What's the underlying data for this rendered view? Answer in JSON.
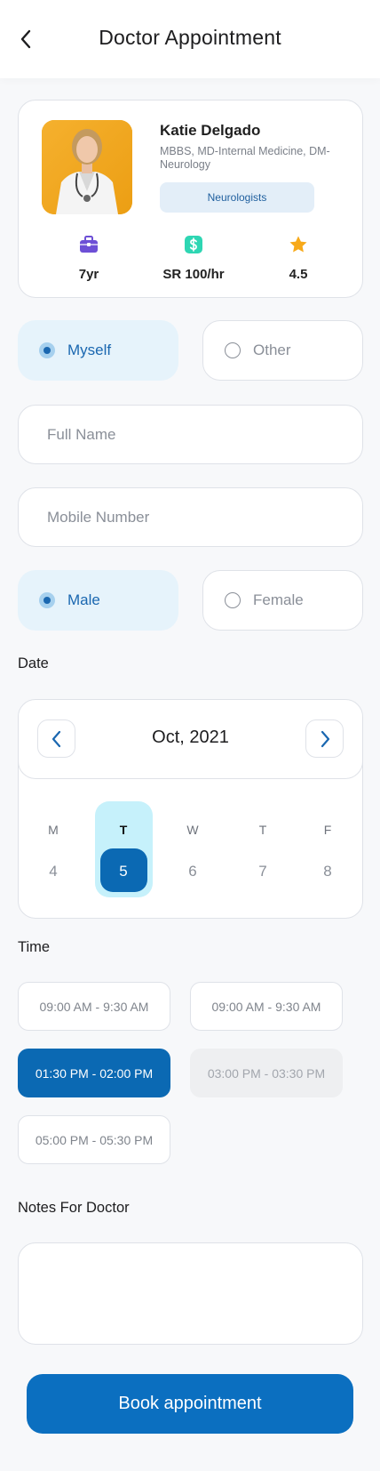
{
  "header": {
    "title": "Doctor Appointment"
  },
  "doctor": {
    "name": "Katie Delgado",
    "qualifications": "MBBS, MD-Internal Medicine, DM-Neurology",
    "specialty": "Neurologists",
    "stats": {
      "experience": "7yr",
      "fee": "SR 100/hr",
      "rating": "4.5"
    }
  },
  "patient_type": {
    "options": [
      "Myself",
      "Other"
    ],
    "selected": "Myself"
  },
  "form": {
    "full_name_placeholder": "Full Name",
    "mobile_placeholder": "Mobile Number"
  },
  "gender": {
    "options": [
      "Male",
      "Female"
    ],
    "selected": "Male"
  },
  "date": {
    "label": "Date",
    "month": "Oct, 2021",
    "weekdays": [
      "M",
      "T",
      "W",
      "T",
      "F"
    ],
    "days": [
      "4",
      "5",
      "6",
      "7",
      "8"
    ],
    "selected_day": "5"
  },
  "time": {
    "label": "Time",
    "slots": [
      {
        "label": "09:00 AM - 9:30 AM",
        "state": "available"
      },
      {
        "label": "09:00 AM - 9:30 AM",
        "state": "available"
      },
      {
        "label": "01:30 PM - 02:00 PM",
        "state": "selected"
      },
      {
        "label": "03:00 PM - 03:30 PM",
        "state": "disabled"
      },
      {
        "label": "05:00 PM - 05:30 PM",
        "state": "available"
      }
    ]
  },
  "notes": {
    "label": "Notes For Doctor",
    "value": ""
  },
  "action": {
    "book_label": "Book appointment"
  },
  "colors": {
    "primary": "#0b6fc0",
    "accent_light": "#e6f3fb",
    "selected_column": "#c6f1fb",
    "experience_icon": "#6d4fd6",
    "fee_icon": "#2ed6b3",
    "rating_icon": "#f7a919"
  },
  "icons": {
    "back": "back-arrow-icon",
    "experience": "briefcase-icon",
    "fee": "dollar-icon",
    "rating": "star-icon",
    "prev_month": "chevron-left-icon",
    "next_month": "chevron-right-icon"
  }
}
